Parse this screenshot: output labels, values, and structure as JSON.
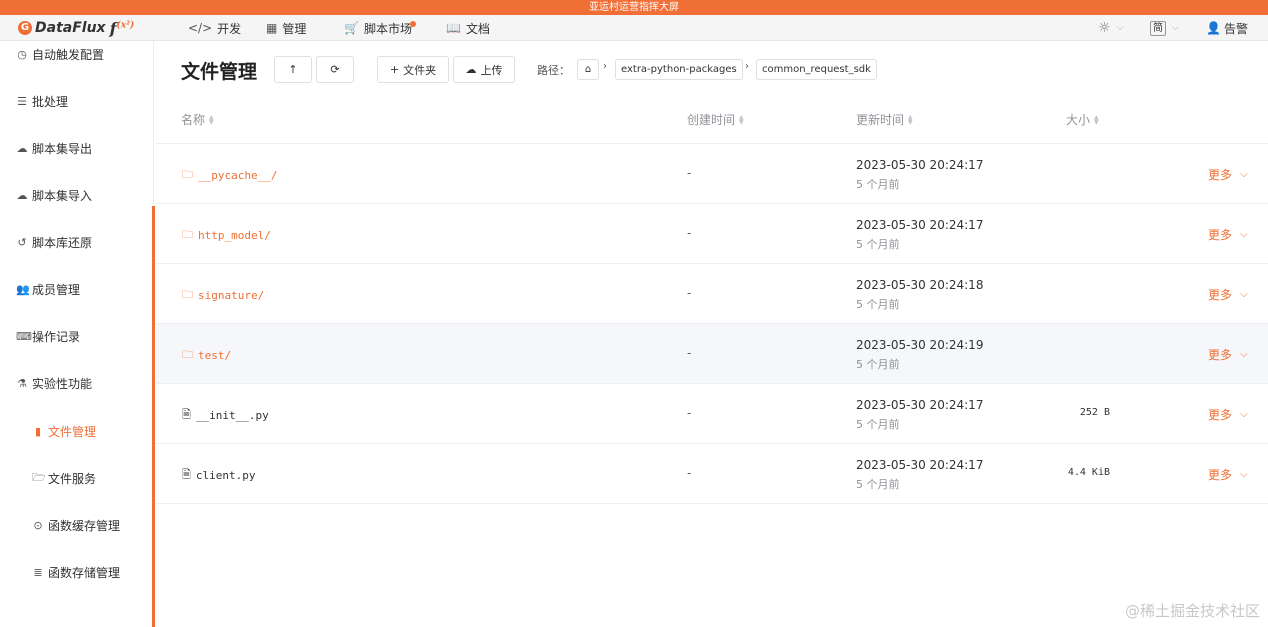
{
  "banner": {
    "text": "亚运村运营指挥大屏"
  },
  "brand": {
    "name": "DataFlux",
    "fx": "f",
    "sup": "(x²)",
    "accent": "#ef6f36"
  },
  "nav": [
    {
      "label": "开发",
      "icon": "code-icon"
    },
    {
      "label": "管理",
      "icon": "grid-icon"
    },
    {
      "label": "脚本市场",
      "icon": "cart-icon"
    },
    {
      "label": "文档",
      "icon": "book-icon"
    }
  ],
  "topright": {
    "lang": "简",
    "user": "告警"
  },
  "sidebar": [
    {
      "label": "自动触发配置",
      "icon": "clock-icon"
    },
    {
      "label": "批处理",
      "icon": "list-icon"
    },
    {
      "label": "脚本集导出",
      "icon": "cloud-download-icon"
    },
    {
      "label": "脚本集导入",
      "icon": "cloud-upload-icon"
    },
    {
      "label": "脚本库还原",
      "icon": "history-icon"
    },
    {
      "label": "成员管理",
      "icon": "users-icon"
    },
    {
      "label": "操作记录",
      "icon": "keyboard-icon"
    },
    {
      "label": "实验性功能",
      "icon": "flask-icon"
    },
    {
      "label": "文件管理",
      "icon": "file-icon"
    },
    {
      "label": "文件服务",
      "icon": "folder-open-icon"
    },
    {
      "label": "函数缓存管理",
      "icon": "dot-circle-icon"
    },
    {
      "label": "函数存储管理",
      "icon": "database-icon"
    }
  ],
  "page": {
    "title": "文件管理",
    "new_folder": "文件夹",
    "upload": "上传",
    "path_label": "路径：",
    "crumbs": [
      "extra-python-packages",
      "common_request_sdk"
    ]
  },
  "table": {
    "headers": {
      "name": "名称",
      "created": "创建时间",
      "updated": "更新时间",
      "size": "大小"
    },
    "rows": [
      {
        "name": "__pycache__/",
        "type": "folder",
        "created": "-",
        "updated": "2023-05-30 20:24:17",
        "relative": "5 个月前",
        "size": "",
        "more": "更多"
      },
      {
        "name": "http_model/",
        "type": "folder",
        "created": "-",
        "updated": "2023-05-30 20:24:17",
        "relative": "5 个月前",
        "size": "",
        "more": "更多"
      },
      {
        "name": "signature/",
        "type": "folder",
        "created": "-",
        "updated": "2023-05-30 20:24:18",
        "relative": "5 个月前",
        "size": "",
        "more": "更多"
      },
      {
        "name": "test/",
        "type": "folder",
        "created": "-",
        "updated": "2023-05-30 20:24:19",
        "relative": "5 个月前",
        "size": "",
        "more": "更多"
      },
      {
        "name": "__init__.py",
        "type": "file",
        "created": "-",
        "updated": "2023-05-30 20:24:17",
        "relative": "5 个月前",
        "size": "252 B",
        "more": "更多"
      },
      {
        "name": "client.py",
        "type": "file",
        "created": "-",
        "updated": "2023-05-30 20:24:17",
        "relative": "5 个月前",
        "size": "4.4 KiB",
        "more": "更多"
      }
    ]
  },
  "watermark": "@稀土掘金技术社区"
}
